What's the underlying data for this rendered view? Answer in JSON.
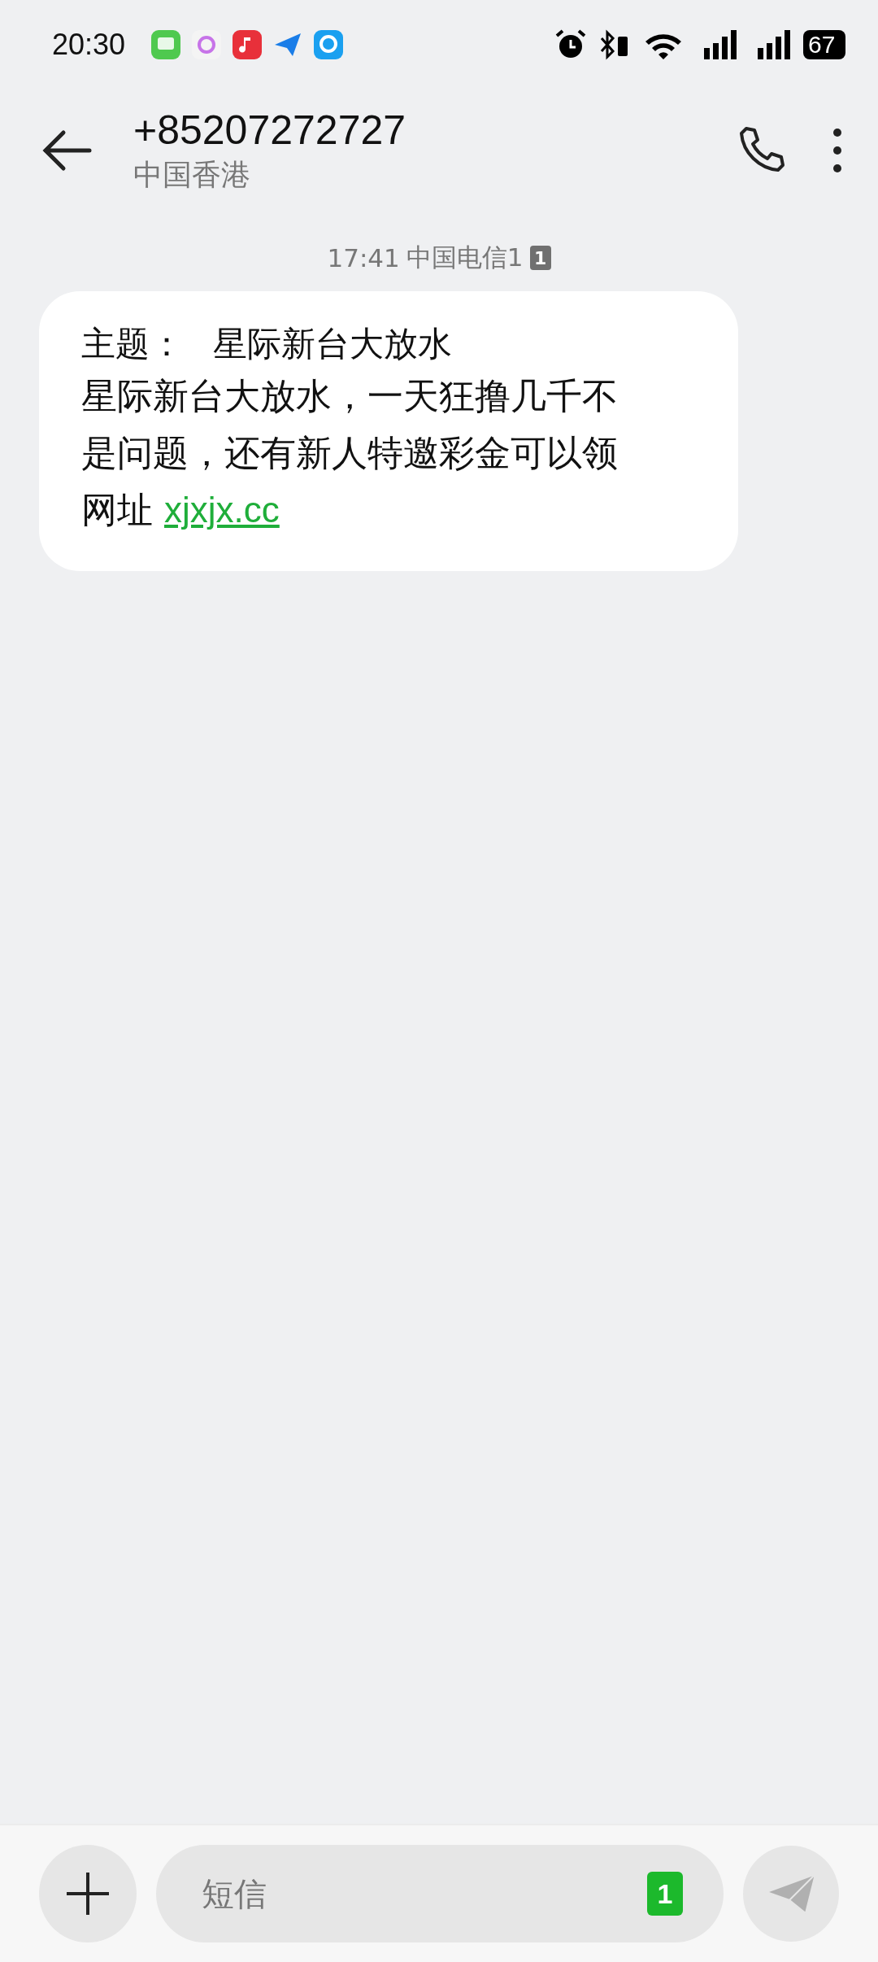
{
  "status_bar": {
    "time": "20:30",
    "battery": "67"
  },
  "header": {
    "title": "+85207272727",
    "subtitle": "中国香港"
  },
  "message": {
    "time": "17:41",
    "carrier": "中国电信1",
    "sim": "1",
    "subject_label": "主题：",
    "subject": "星际新台大放水",
    "body": "星际新台大放水，一天狂撸几千不是问题，还有新人特邀彩金可以领网址",
    "link": "xjxjx.cc"
  },
  "composer": {
    "placeholder": "短信",
    "sim": "1"
  }
}
